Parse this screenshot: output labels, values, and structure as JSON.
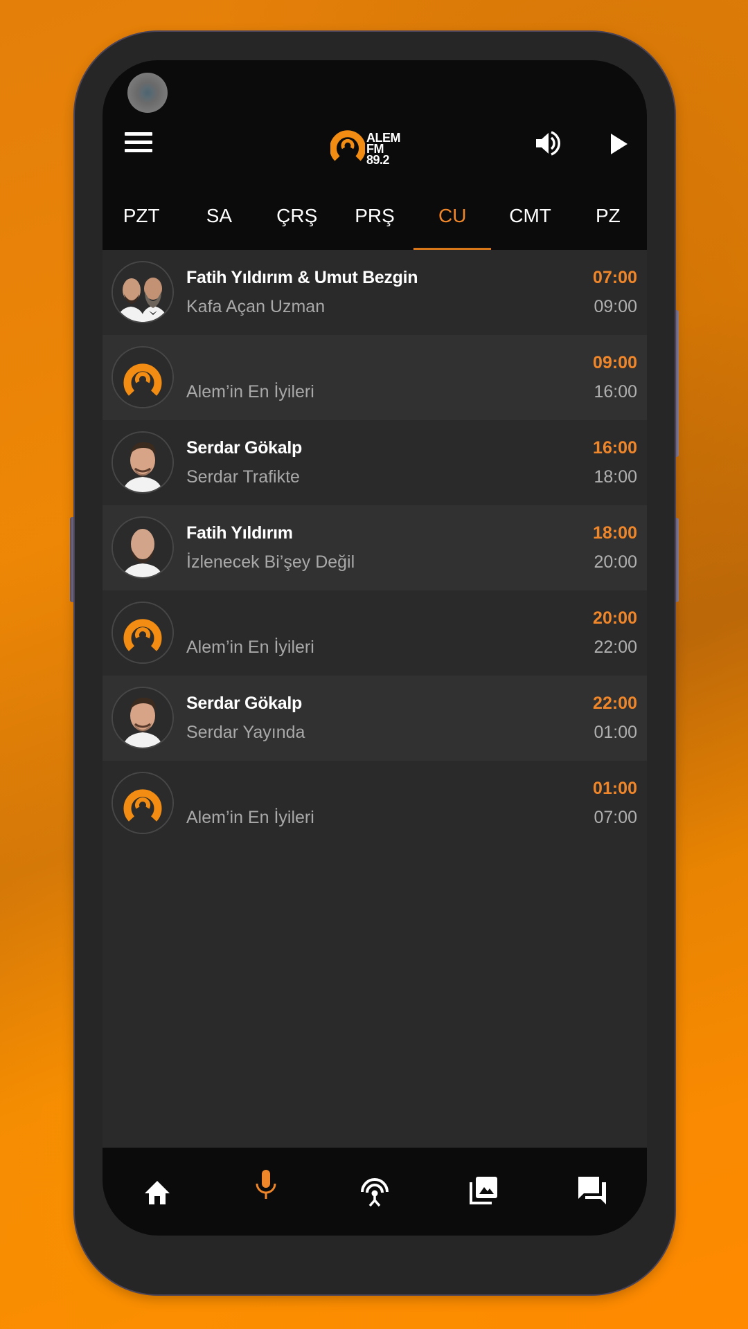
{
  "app": {
    "name": "ALEM FM",
    "frequency": "89.2",
    "accent_color": "#f0862a",
    "indicator_color": "#d8761a"
  },
  "header": {
    "menu_icon": "hamburger-menu-icon",
    "volume_icon": "volume-up-icon",
    "play_icon": "play-icon"
  },
  "tabs": [
    {
      "label": "PZT",
      "active": false
    },
    {
      "label": "SA",
      "active": false
    },
    {
      "label": "ÇRŞ",
      "active": false
    },
    {
      "label": "PRŞ",
      "active": false
    },
    {
      "label": "CU",
      "active": true
    },
    {
      "label": "CMT",
      "active": false
    },
    {
      "label": "PZ",
      "active": false
    }
  ],
  "schedule": [
    {
      "host": "Fatih Yıldırım & Umut Bezgin",
      "show": "Kafa Açan Uzman",
      "start": "07:00",
      "end": "09:00",
      "avatar": "host-photo-duo"
    },
    {
      "host": "",
      "show": "Alem’in En İyileri",
      "start": "09:00",
      "end": "16:00",
      "avatar": "station-logo"
    },
    {
      "host": "Serdar Gökalp",
      "show": "Serdar Trafikte",
      "start": "16:00",
      "end": "18:00",
      "avatar": "host-photo-serdar"
    },
    {
      "host": "Fatih Yıldırım",
      "show": "İzlenecek Bi’şey Değil",
      "start": "18:00",
      "end": "20:00",
      "avatar": "host-photo-fatih"
    },
    {
      "host": "",
      "show": "Alem’in En İyileri",
      "start": "20:00",
      "end": "22:00",
      "avatar": "station-logo"
    },
    {
      "host": "Serdar Gökalp",
      "show": "Serdar Yayında",
      "start": "22:00",
      "end": "01:00",
      "avatar": "host-photo-serdar"
    },
    {
      "host": "",
      "show": "Alem’in En İyileri",
      "start": "01:00",
      "end": "07:00",
      "avatar": "station-logo"
    }
  ],
  "bottom_nav": [
    {
      "icon": "home-icon",
      "active": false
    },
    {
      "icon": "microphone-icon",
      "active": true
    },
    {
      "icon": "podcast-broadcast-icon",
      "active": false
    },
    {
      "icon": "photo-gallery-icon",
      "active": false
    },
    {
      "icon": "chat-forum-icon",
      "active": false
    }
  ]
}
